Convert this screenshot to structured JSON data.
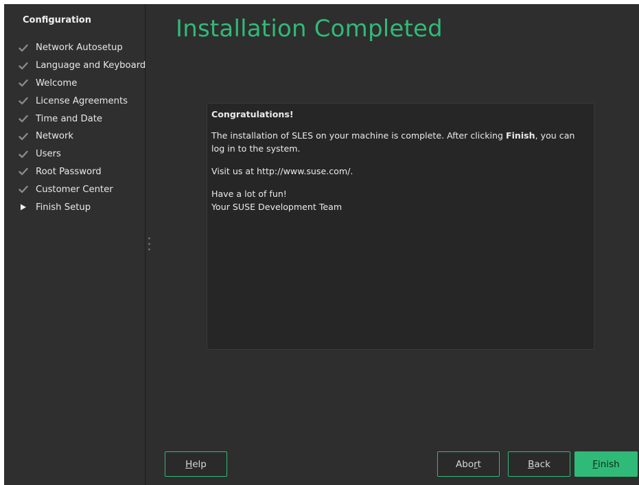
{
  "sidebar": {
    "title": "Configuration",
    "steps": [
      {
        "label": "Network Autosetup",
        "state": "done"
      },
      {
        "label": "Language and Keyboard",
        "state": "done"
      },
      {
        "label": "Welcome",
        "state": "done"
      },
      {
        "label": "License Agreements",
        "state": "done"
      },
      {
        "label": "Time and Date",
        "state": "done"
      },
      {
        "label": "Network",
        "state": "done"
      },
      {
        "label": "Users",
        "state": "done"
      },
      {
        "label": "Root Password",
        "state": "done"
      },
      {
        "label": "Customer Center",
        "state": "done"
      },
      {
        "label": "Finish Setup",
        "state": "current"
      }
    ]
  },
  "main": {
    "title": "Installation Completed",
    "message": {
      "heading": "Congratulations!",
      "line1_before": "The installation of SLES on your machine is complete. After clicking ",
      "line1_bold": "Finish",
      "line1_after": ", you can log in to the system.",
      "line2": "Visit us at http://www.suse.com/.",
      "line3": "Have a lot of fun!",
      "line4": "Your SUSE Development Team"
    }
  },
  "buttons": {
    "help": {
      "mnemonic": "H",
      "rest": "elp"
    },
    "abort": {
      "before": "Abo",
      "mnemonic": "r",
      "after": "t"
    },
    "back": {
      "mnemonic": "B",
      "rest": "ack"
    },
    "finish": {
      "mnemonic": "F",
      "rest": "inish"
    }
  },
  "colors": {
    "accent": "#30ba78",
    "background": "#2e2e2e",
    "text": "#eaeaea"
  },
  "icons": {
    "done": "checkmark-icon",
    "current": "triangle-right-icon"
  }
}
